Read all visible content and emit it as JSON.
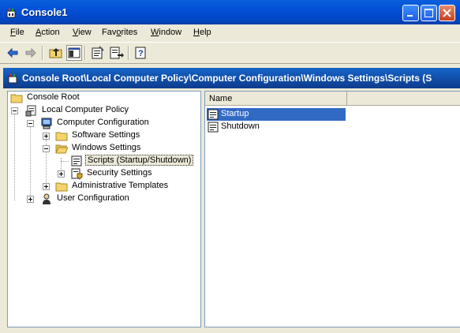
{
  "window": {
    "title": "Console1"
  },
  "menubar": [
    {
      "label": "File",
      "accel": "F",
      "rest": "ile"
    },
    {
      "label": "Action",
      "accel": "A",
      "rest": "ction"
    },
    {
      "label": "View",
      "accel": "V",
      "rest": "iew"
    },
    {
      "label": "Favorites",
      "accel": "o",
      "pre": "Fav",
      "rest": "rites"
    },
    {
      "label": "Window",
      "accel": "W",
      "rest": "indow"
    },
    {
      "label": "Help",
      "accel": "H",
      "rest": "elp"
    }
  ],
  "toolbar": {
    "buttons": [
      "back-icon",
      "forward-icon",
      "up-one-level-icon",
      "show-hide-tree-icon",
      "properties-icon",
      "export-list-icon",
      "help-icon"
    ]
  },
  "address": {
    "path": "Console Root\\Local Computer Policy\\Computer Configuration\\Windows Settings\\Scripts (S"
  },
  "tree": {
    "items": [
      {
        "label": "Console Root",
        "icon": "folder-icon"
      },
      {
        "label": "Local Computer Policy",
        "icon": "policy-icon"
      },
      {
        "label": "Computer Configuration",
        "icon": "computer-icon"
      },
      {
        "label": "Software Settings",
        "icon": "folder-icon"
      },
      {
        "label": "Windows Settings",
        "icon": "folder-icon"
      },
      {
        "label": "Scripts (Startup/Shutdown)",
        "icon": "scripts-icon"
      },
      {
        "label": "Security Settings",
        "icon": "security-icon"
      },
      {
        "label": "Administrative Templates",
        "icon": "folder-icon"
      },
      {
        "label": "User Configuration",
        "icon": "user-icon"
      }
    ]
  },
  "list": {
    "columns": [
      "Name"
    ],
    "items": [
      {
        "label": "Startup",
        "icon": "script-icon",
        "selected": true
      },
      {
        "label": "Shutdown",
        "icon": "script-icon",
        "selected": false
      }
    ]
  },
  "colors": {
    "title_bar": "#0350d6",
    "selection": "#316ac5",
    "face": "#ece9d8"
  }
}
